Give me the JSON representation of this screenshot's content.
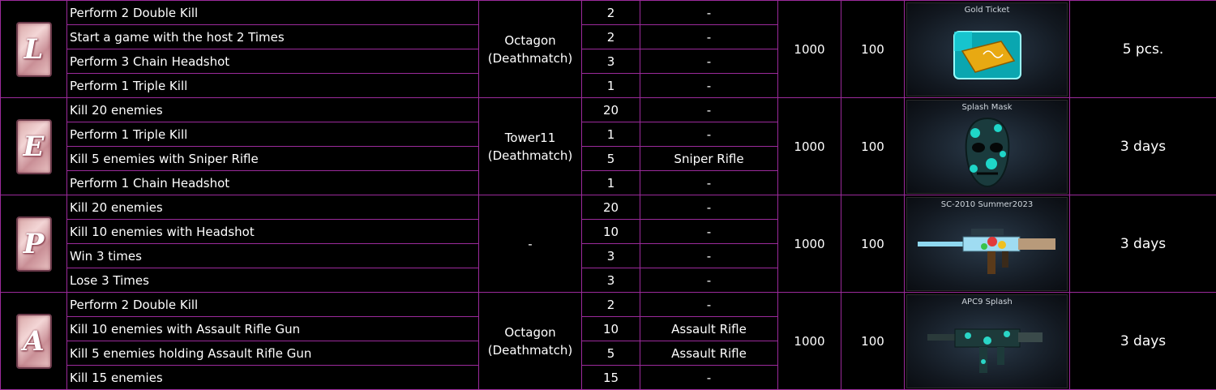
{
  "groups": [
    {
      "letter": "L",
      "map_line1": "Octagon",
      "map_line2": "(Deathmatch)",
      "exp": "1000",
      "points": "100",
      "reward_name": "Gold Ticket",
      "reward_qty": "5 pcs.",
      "tasks": [
        {
          "text": "Perform 2 Double Kill",
          "count": "2",
          "weapon": "-"
        },
        {
          "text": "Start a game with the host 2 Times",
          "count": "2",
          "weapon": "-"
        },
        {
          "text": "Perform 3 Chain Headshot",
          "count": "3",
          "weapon": "-"
        },
        {
          "text": "Perform 1 Triple Kill",
          "count": "1",
          "weapon": "-"
        }
      ]
    },
    {
      "letter": "E",
      "map_line1": "Tower11",
      "map_line2": "(Deathmatch)",
      "exp": "1000",
      "points": "100",
      "reward_name": "Splash Mask",
      "reward_qty": "3 days",
      "tasks": [
        {
          "text": "Kill 20 enemies",
          "count": "20",
          "weapon": "-"
        },
        {
          "text": "Perform 1 Triple Kill",
          "count": "1",
          "weapon": "-"
        },
        {
          "text": "Kill 5 enemies with Sniper Rifle",
          "count": "5",
          "weapon": "Sniper Rifle"
        },
        {
          "text": "Perform 1 Chain Headshot",
          "count": "1",
          "weapon": "-"
        }
      ]
    },
    {
      "letter": "P",
      "map_line1": "-",
      "map_line2": "",
      "exp": "1000",
      "points": "100",
      "reward_name": "SC-2010 Summer2023",
      "reward_qty": "3 days",
      "tasks": [
        {
          "text": "Kill 20 enemies",
          "count": "20",
          "weapon": "-"
        },
        {
          "text": "Kill 10 enemies with Headshot",
          "count": "10",
          "weapon": "-"
        },
        {
          "text": "Win 3 times",
          "count": "3",
          "weapon": "-"
        },
        {
          "text": "Lose 3 Times",
          "count": "3",
          "weapon": "-"
        }
      ]
    },
    {
      "letter": "A",
      "map_line1": "Octagon",
      "map_line2": "(Deathmatch)",
      "exp": "1000",
      "points": "100",
      "reward_name": "APC9 Splash",
      "reward_qty": "3 days",
      "tasks": [
        {
          "text": "Perform 2 Double Kill",
          "count": "2",
          "weapon": "-"
        },
        {
          "text": "Kill 10 enemies with Assault Rifle Gun",
          "count": "10",
          "weapon": "Assault Rifle"
        },
        {
          "text": "Kill 5 enemies holding Assault Rifle Gun",
          "count": "5",
          "weapon": "Assault Rifle"
        },
        {
          "text": "Kill 15 enemies",
          "count": "15",
          "weapon": "-"
        }
      ]
    }
  ]
}
